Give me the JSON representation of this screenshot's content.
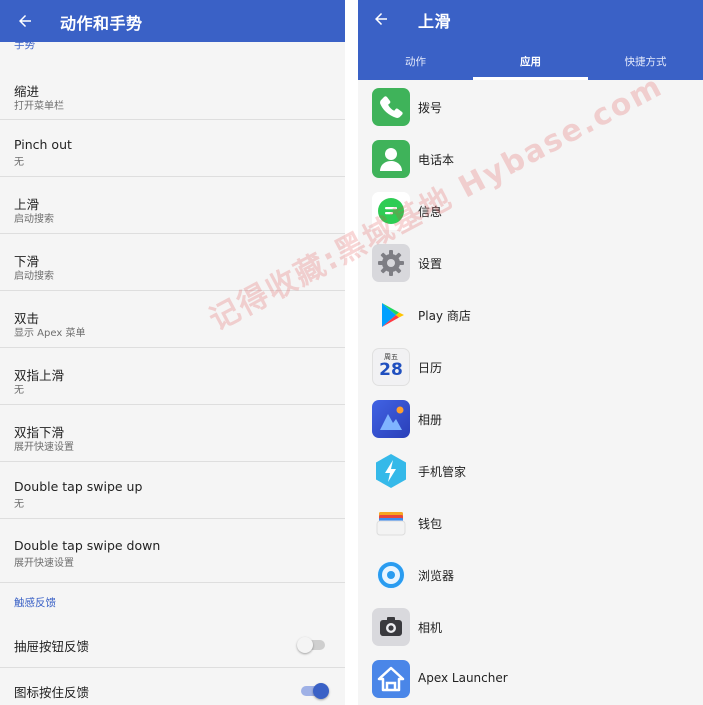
{
  "left": {
    "title": "动作和手势",
    "gestures_header": "手势",
    "items": [
      {
        "title": "缩进",
        "subtitle": "打开菜单栏"
      },
      {
        "title": "Pinch out",
        "subtitle": "无"
      },
      {
        "title": "上滑",
        "subtitle": "启动搜索"
      },
      {
        "title": "下滑",
        "subtitle": "启动搜索"
      },
      {
        "title": "双击",
        "subtitle": "显示 Apex 菜单"
      },
      {
        "title": "双指上滑",
        "subtitle": "无"
      },
      {
        "title": "双指下滑",
        "subtitle": "展开快速设置"
      },
      {
        "title": "Double tap swipe up",
        "subtitle": "无"
      },
      {
        "title": "Double tap swipe down",
        "subtitle": "展开快速设置"
      }
    ],
    "haptic_header": "触感反馈",
    "toggles": [
      {
        "label": "抽屉按钮反馈",
        "state": "off"
      },
      {
        "label": "图标按住反馈",
        "state": "on"
      }
    ]
  },
  "right": {
    "title": "上滑",
    "tabs": [
      {
        "label": "动作",
        "active": false
      },
      {
        "label": "应用",
        "active": true
      },
      {
        "label": "快捷方式",
        "active": false
      }
    ],
    "apps": [
      {
        "label": "拨号",
        "icon": "phone-icon"
      },
      {
        "label": "电话本",
        "icon": "contacts-icon"
      },
      {
        "label": "信息",
        "icon": "messages-icon"
      },
      {
        "label": "设置",
        "icon": "settings-gear-icon"
      },
      {
        "label": "Play 商店",
        "icon": "play-store-icon"
      },
      {
        "label": "日历",
        "icon": "calendar-icon",
        "calendar_day": "周五",
        "calendar_date": "28"
      },
      {
        "label": "相册",
        "icon": "gallery-icon"
      },
      {
        "label": "手机管家",
        "icon": "phone-manager-icon"
      },
      {
        "label": "钱包",
        "icon": "wallet-icon"
      },
      {
        "label": "浏览器",
        "icon": "browser-icon"
      },
      {
        "label": "相机",
        "icon": "camera-icon"
      },
      {
        "label": "Apex Launcher",
        "icon": "apex-launcher-icon"
      }
    ]
  },
  "watermark": "记得收藏:黑域基地 Hybase.com",
  "colors": {
    "primary": "#3a61c6",
    "background": "#f5f5f5",
    "divider": "#dedede",
    "watermark": "#e14646"
  }
}
